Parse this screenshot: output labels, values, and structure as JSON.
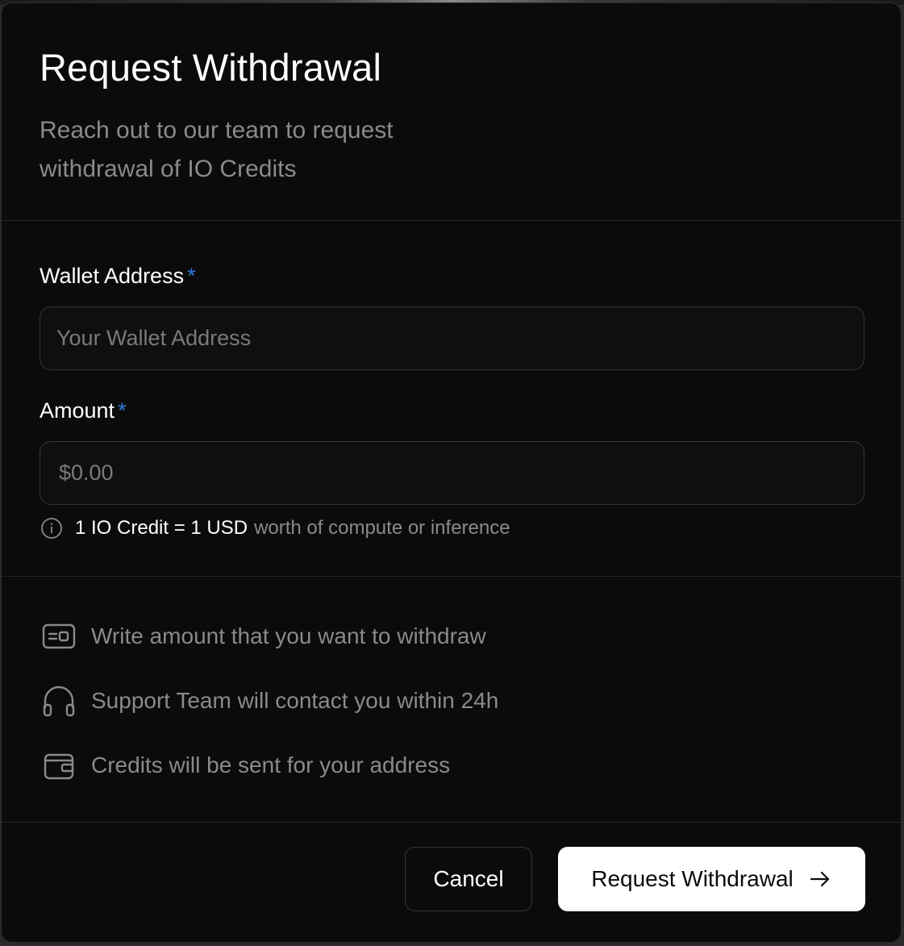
{
  "dialog": {
    "title": "Request Withdrawal",
    "subtitle": "Reach out to our team to request withdrawal of IO Credits"
  },
  "form": {
    "wallet": {
      "label": "Wallet Address",
      "required_mark": "*",
      "placeholder": "Your Wallet Address",
      "value": ""
    },
    "amount": {
      "label": "Amount",
      "required_mark": "*",
      "placeholder": "$0.00",
      "value": ""
    },
    "hint": {
      "icon": "info-icon",
      "strong": "1 IO Credit = 1 USD",
      "rest": "worth of compute or inference"
    }
  },
  "steps": [
    {
      "icon": "card-icon",
      "text": "Write amount that you want to withdraw"
    },
    {
      "icon": "headphones-icon",
      "text": "Support Team will contact you within 24h"
    },
    {
      "icon": "wallet-icon",
      "text": "Credits will be sent for your address"
    }
  ],
  "footer": {
    "cancel_label": "Cancel",
    "submit_label": "Request Withdrawal",
    "submit_icon": "arrow-right-icon"
  },
  "colors": {
    "background": "#0b0b0b",
    "accent_required": "#2f7de1",
    "muted_text": "#8a8a8e",
    "primary_button": "#ffffff"
  }
}
